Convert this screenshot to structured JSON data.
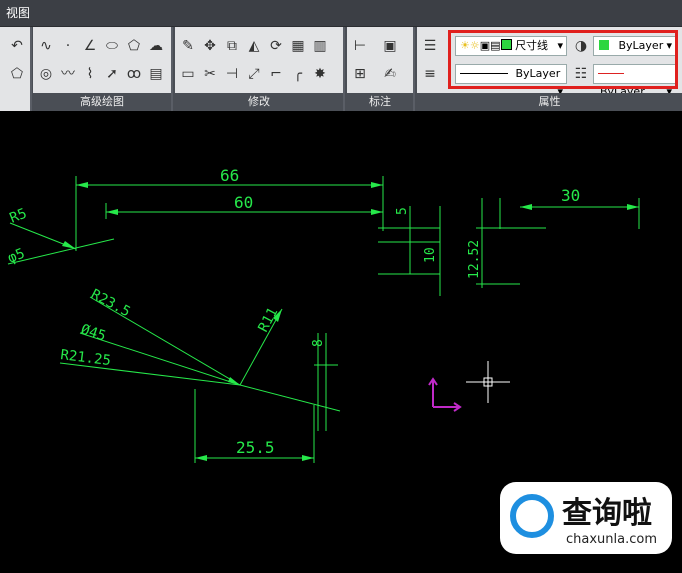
{
  "titlebar": {
    "label": "视图"
  },
  "ribbon": {
    "panels": {
      "draw_advanced": "高级绘图",
      "modify": "修改",
      "annotate": "标注",
      "properties": "属性"
    },
    "properties": {
      "layer": "尺寸线",
      "color_label": "ByLayer",
      "linetype_label": "ByLayer",
      "lineweight_label": "ByLayer"
    }
  },
  "drawing": {
    "dims": {
      "d66": "66",
      "d60": "60",
      "d30": "30",
      "d5": "5",
      "d10": "10",
      "d1252": "12.52",
      "r5": "R5",
      "phi5": "φ5",
      "r235": "R23.5",
      "phi45": "Ø45",
      "r2125": "R21.25",
      "r11": "R11",
      "d8": "8",
      "d255": "25.5"
    }
  },
  "watermark": {
    "brand": "查询啦",
    "url": "chaxunla.com"
  },
  "colors": {
    "dim": "#26e84a",
    "highlight": "#e0201e",
    "ucs": "#c02ac8"
  }
}
